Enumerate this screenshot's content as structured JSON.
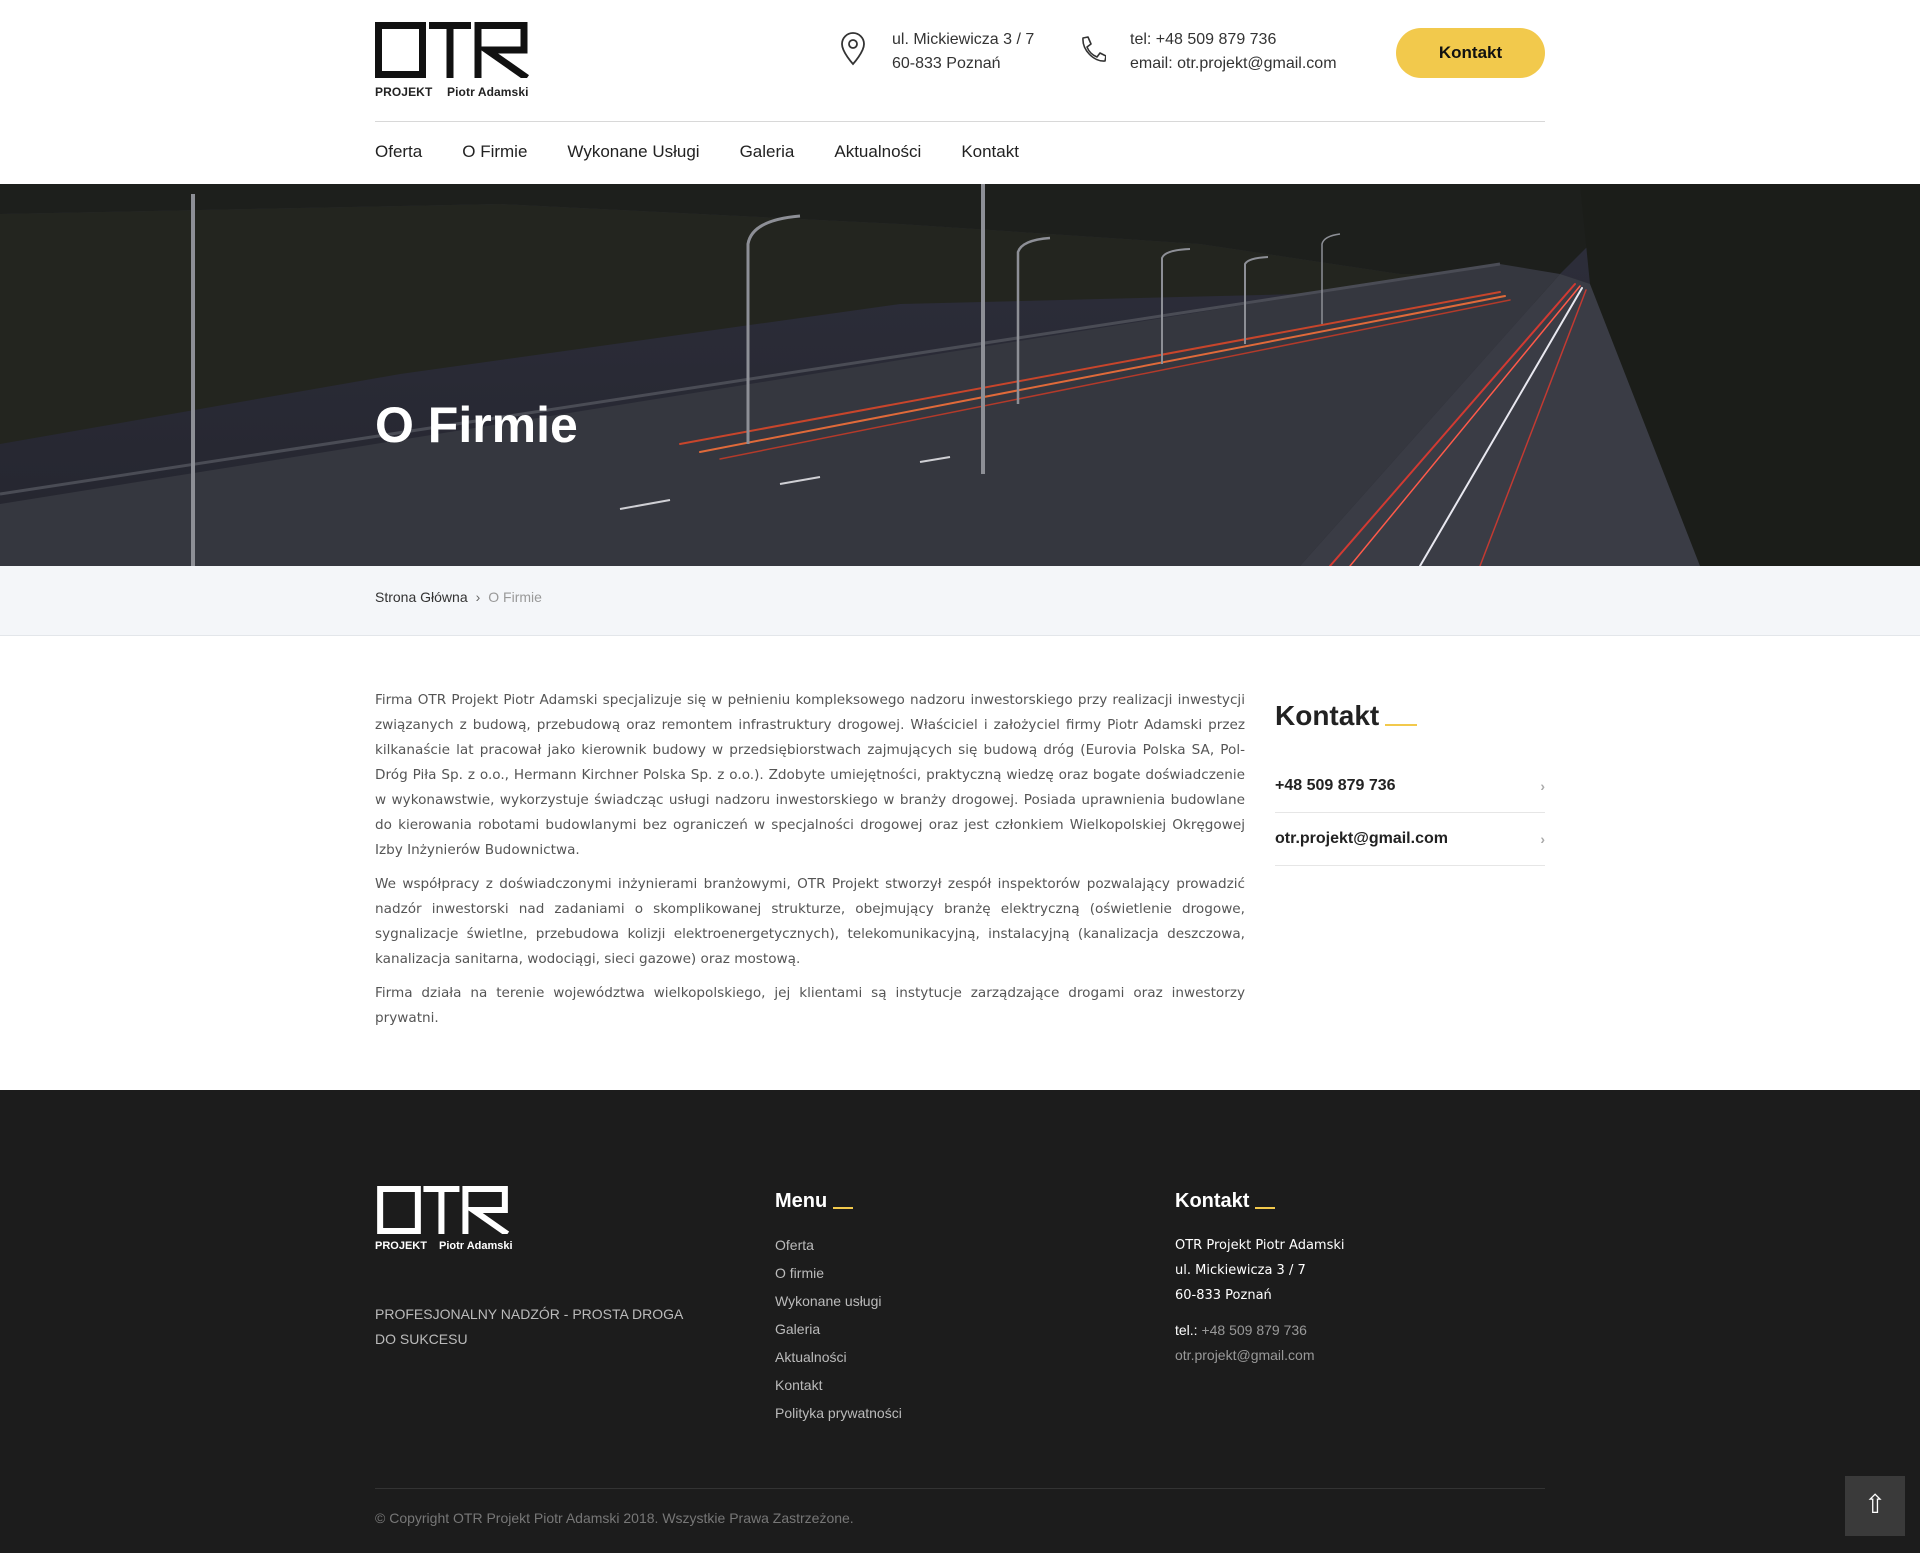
{
  "header": {
    "logo": {
      "brand": "OTR",
      "line1": "PROJEKT",
      "line2": "Piotr Adamski"
    },
    "address": {
      "line1": "ul. Mickiewicza 3 / 7",
      "line2": "60-833 Poznań",
      "icon": "map-pin-icon"
    },
    "contact": {
      "line1": "tel: +48 509 879 736",
      "line2": "email: otr.projekt@gmail.com",
      "icon": "phone-icon"
    },
    "cta_label": "Kontakt",
    "accent": "#f2c94c"
  },
  "nav": [
    "Oferta",
    "O Firmie",
    "Wykonane Usługi",
    "Galeria",
    "Aktualności",
    "Kontakt"
  ],
  "hero": {
    "title": "O Firmie"
  },
  "breadcrumb": {
    "home": "Strona Główna",
    "current": "O Firmie",
    "separator_icon": "chevron-right-icon"
  },
  "article": {
    "paragraphs": [
      "Firma OTR Projekt Piotr Adamski specjalizuje się w pełnieniu kompleksowego nadzoru inwestorskiego przy realizacji inwestycji związanych z budową, przebudową oraz remontem infrastruktury drogowej. Właściciel i założyciel firmy Piotr Adamski przez kilkanaście lat pracował jako kierownik budowy w przedsiębiorstwach zajmujących się budową dróg (Eurovia Polska SA, Pol-Dróg Piła Sp. z o.o., Hermann Kirchner Polska Sp. z o.o.). Zdobyte umiejętności, praktyczną wiedzę oraz bogate doświadczenie w wykonawstwie, wykorzystuje świadcząc usługi nadzoru inwestorskiego w branży drogowej. Posiada uprawnienia budowlane do kierowania robotami budowlanymi bez ograniczeń w specjalności drogowej oraz jest członkiem Wielkopolskiej Okręgowej Izby Inżynierów Budownictwa.",
      "We współpracy z doświadczonymi inżynierami branżowymi, OTR Projekt stworzył zespół inspektorów pozwalający prowadzić nadzór inwestorski nad zadaniami o skomplikowanej strukturze, obejmujący branżę elektryczną (oświetlenie drogowe, sygnalizacje świetlne, przebudowa kolizji elektroenergetycznych), telekomunikacyjną, instalacyjną (kanalizacja deszczowa, kanalizacja sanitarna, wodociągi, sieci gazowe) oraz mostową.",
      "Firma działa na terenie województwa wielkopolskiego, jej klientami są instytucje zarządzające drogami oraz inwestorzy prywatni."
    ]
  },
  "sidebar": {
    "title": "Kontakt",
    "items": [
      "+48 509 879 736",
      "otr.projekt@gmail.com"
    ]
  },
  "footer": {
    "tagline": "PROFESJONALNY NADZÓR - PROSTA DROGA DO SUKCESU",
    "menu_title": "Menu",
    "menu": [
      "Oferta",
      "O firmie",
      "Wykonane usługi",
      "Galeria",
      "Aktualności",
      "Kontakt",
      "Polityka prywatności"
    ],
    "kontakt_title": "Kontakt",
    "company": "OTR Projekt Piotr Adamski",
    "street": "ul. Mickiewicza 3 / 7",
    "city": "60-833 Poznań",
    "tel_label": "tel.:",
    "tel": "+48 509 879 736",
    "email": "otr.projekt@gmail.com",
    "copyright": "© Copyright OTR Projekt Piotr Adamski 2018. Wszystkie Prawa Zastrzeżone.",
    "back_to_top_icon": "double-chevron-up-icon"
  }
}
